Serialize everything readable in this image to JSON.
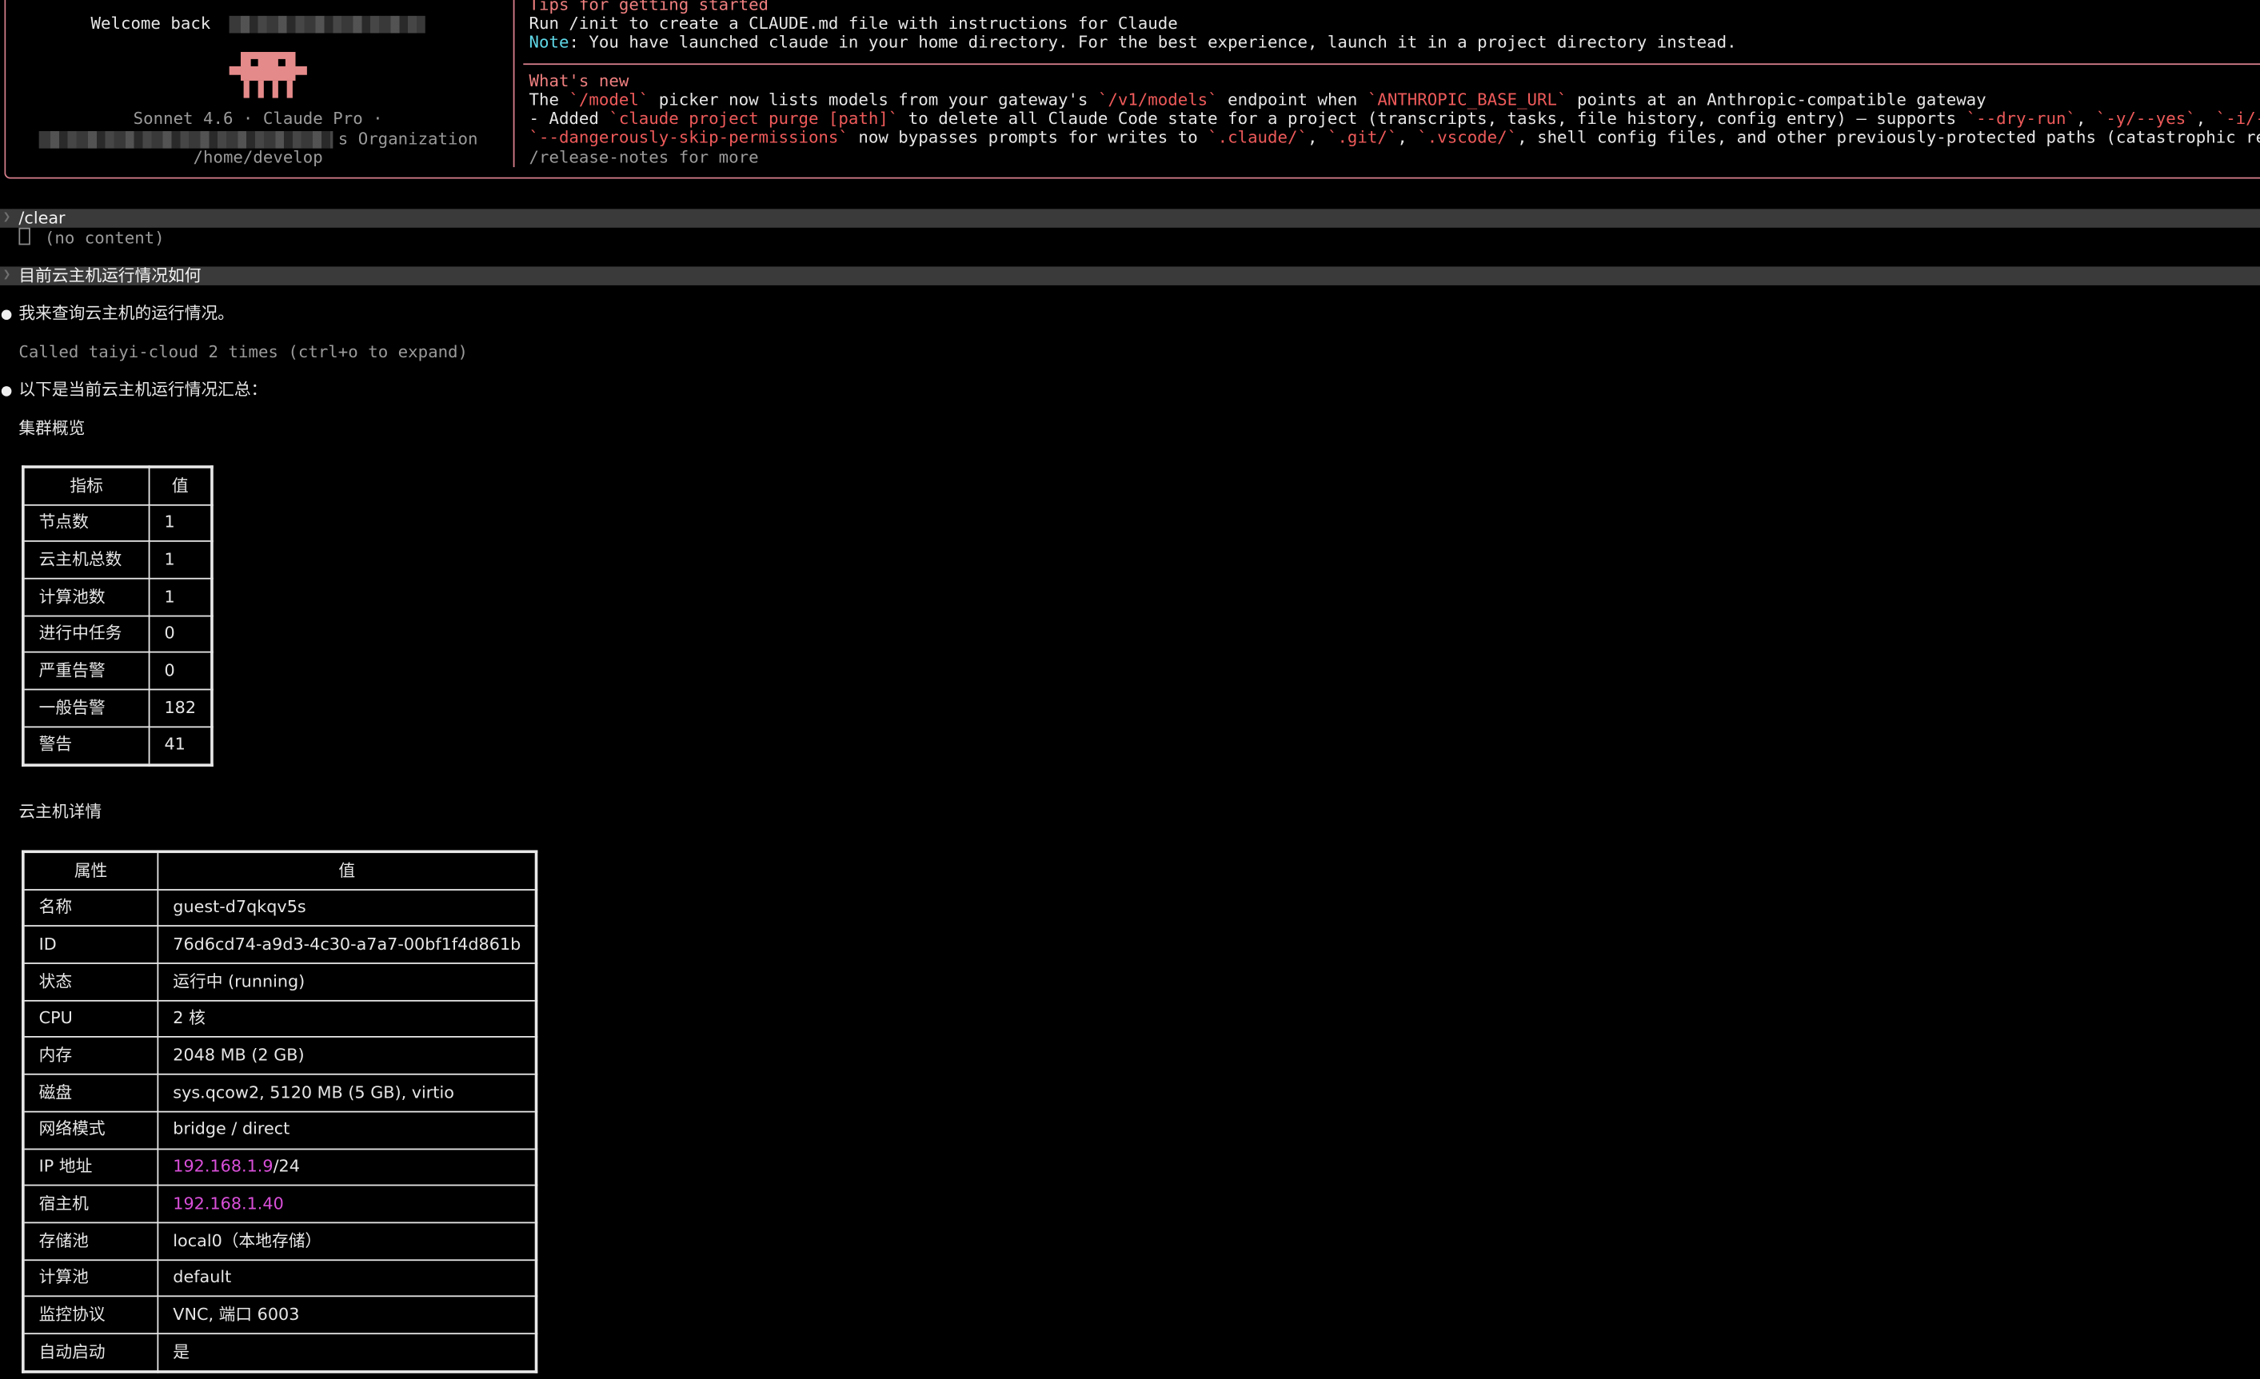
{
  "welcome": {
    "greeting": "Welcome back",
    "model_line": "Sonnet 4.6 · Claude Pro ·",
    "org_suffix": "s Organization",
    "cwd": "/home/develop"
  },
  "tips": {
    "heading": "Tips for getting started",
    "line1": "Run /init to create a CLAUDE.md file with instructions for Claude",
    "note_label": "Note",
    "note_text": ": You have launched claude in your home directory. For the best experience, launch it in a project directory instead."
  },
  "whats_new": {
    "heading": "What's new",
    "line1": [
      {
        "t": "The ",
        "c": ""
      },
      {
        "t": "`/model`",
        "c": "accent-red"
      },
      {
        "t": " picker now lists models from your gateway's ",
        "c": ""
      },
      {
        "t": "`/v1/models`",
        "c": "accent-red"
      },
      {
        "t": " endpoint when ",
        "c": ""
      },
      {
        "t": "`ANTHROPIC_BASE_URL`",
        "c": "accent-red"
      },
      {
        "t": " points at an Anthropic-compatible gateway",
        "c": ""
      }
    ],
    "line2": [
      {
        "t": "- Added ",
        "c": ""
      },
      {
        "t": "`claude project purge [path]`",
        "c": "accent-red"
      },
      {
        "t": " to delete all Claude Code state for a project (transcripts, tasks, file history, config entry) — supports ",
        "c": ""
      },
      {
        "t": "`--dry-run`",
        "c": "accent-red"
      },
      {
        "t": ", ",
        "c": ""
      },
      {
        "t": "`-y/--yes`",
        "c": "accent-red"
      },
      {
        "t": ", ",
        "c": ""
      },
      {
        "t": "`-i/--intera",
        "c": "accent-red"
      }
    ],
    "line3": [
      {
        "t": "`--dangerously-skip-permissions`",
        "c": "accent-red"
      },
      {
        "t": " now bypasses prompts for writes to ",
        "c": ""
      },
      {
        "t": "`.claude/`",
        "c": "accent-red"
      },
      {
        "t": ", ",
        "c": ""
      },
      {
        "t": "`.git/`",
        "c": "accent-red"
      },
      {
        "t": ", ",
        "c": ""
      },
      {
        "t": "`.vscode/`",
        "c": "accent-red"
      },
      {
        "t": ", shell config files, and other previously-protected paths (catastrophic removal c",
        "c": ""
      }
    ],
    "more": "/release-notes for more"
  },
  "transcript": {
    "cmd1": "/clear",
    "cmd1_output": "(no content)",
    "user_prompt": "目前云主机运行情况如何",
    "reply1": "我来查询云主机的运行情况。",
    "tool_summary": "Called taiyi-cloud 2 times (ctrl+o to expand)",
    "reply2": "以下是当前云主机运行情况汇总：",
    "section1": "集群概览",
    "section2": "云主机详情"
  },
  "overview_table": {
    "headers": [
      "指标",
      "值"
    ],
    "rows": [
      [
        "节点数",
        "1"
      ],
      [
        "云主机总数",
        "1"
      ],
      [
        "计算池数",
        "1"
      ],
      [
        "进行中任务",
        "0"
      ],
      [
        "严重告警",
        "0"
      ],
      [
        "一般告警",
        "182"
      ],
      [
        "警告",
        "41"
      ]
    ]
  },
  "detail_table": {
    "headers": [
      "属性",
      "值"
    ],
    "rows": [
      [
        "名称",
        "guest-d7qkqv5s"
      ],
      [
        "ID",
        "76d6cd74-a9d3-4c30-a7a7-00bf1f4d861b"
      ],
      [
        "状态",
        "运行中 (running)"
      ],
      [
        "CPU",
        "2 核"
      ],
      [
        "内存",
        "2048 MB (2 GB)"
      ],
      [
        "磁盘",
        "sys.qcow2, 5120 MB (5 GB), virtio"
      ],
      [
        "网络模式",
        "bridge / direct"
      ],
      [
        "IP 地址",
        "192.168.1.9/24"
      ],
      [
        "宿主机",
        "192.168.1.40"
      ],
      [
        "存储池",
        "local0（本地存储）"
      ],
      [
        "计算池",
        "default"
      ],
      [
        "监控协议",
        "VNC, 端口 6003"
      ],
      [
        "自动启动",
        "是"
      ]
    ],
    "ip_highlight": "192.168.1.9",
    "ip_suffix": "/24"
  },
  "colors": {
    "accent_border": "#d77f8c",
    "heading_salmon": "#ef7f7f",
    "code_red": "#ee5a5a",
    "note_cyan": "#5fd7e6",
    "ip_magenta": "#d94fd9",
    "mascot": "#e58a8a"
  }
}
